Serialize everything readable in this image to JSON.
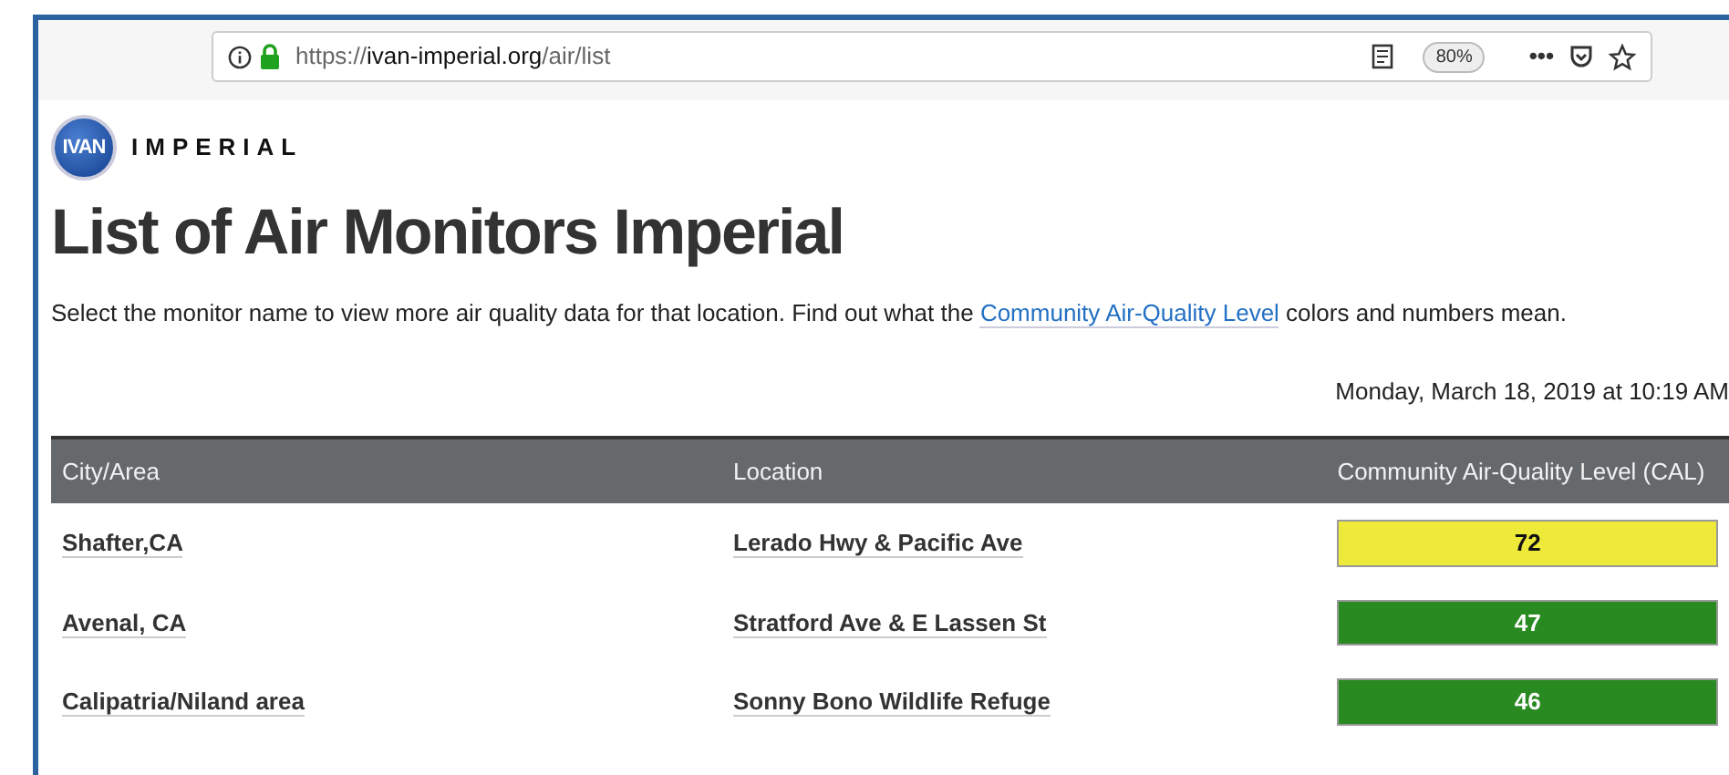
{
  "browser": {
    "url_prefix": "https://",
    "url_host": "ivan-imperial.org",
    "url_path": "/air/list",
    "zoom": "80%",
    "menu": "•••"
  },
  "logo": {
    "badge": "IVAN",
    "brand": "IMPERIAL"
  },
  "title": "List of Air Monitors Imperial",
  "intro": {
    "before": "Select the monitor name to view more air quality data for that location. Find out what the ",
    "link": "Community Air-Quality Level",
    "after": " colors and numbers mean."
  },
  "timestamp": "Monday, March 18, 2019 at 10:19 AM",
  "table": {
    "columns": [
      "City/Area",
      "Location",
      "Community Air-Quality Level (CAL)"
    ],
    "rows": [
      {
        "city": "Shafter,CA",
        "location": "Lerado Hwy & Pacific Ave",
        "cal": "72",
        "color": "#eeea3a"
      },
      {
        "city": "Avenal, CA",
        "location": "Stratford Ave & E Lassen St",
        "cal": "47",
        "color": "#2a8a22"
      },
      {
        "city": "Calipatria/Niland area",
        "location": "Sonny Bono Wildlife Refuge",
        "cal": "46",
        "color": "#2a8a22"
      }
    ]
  }
}
